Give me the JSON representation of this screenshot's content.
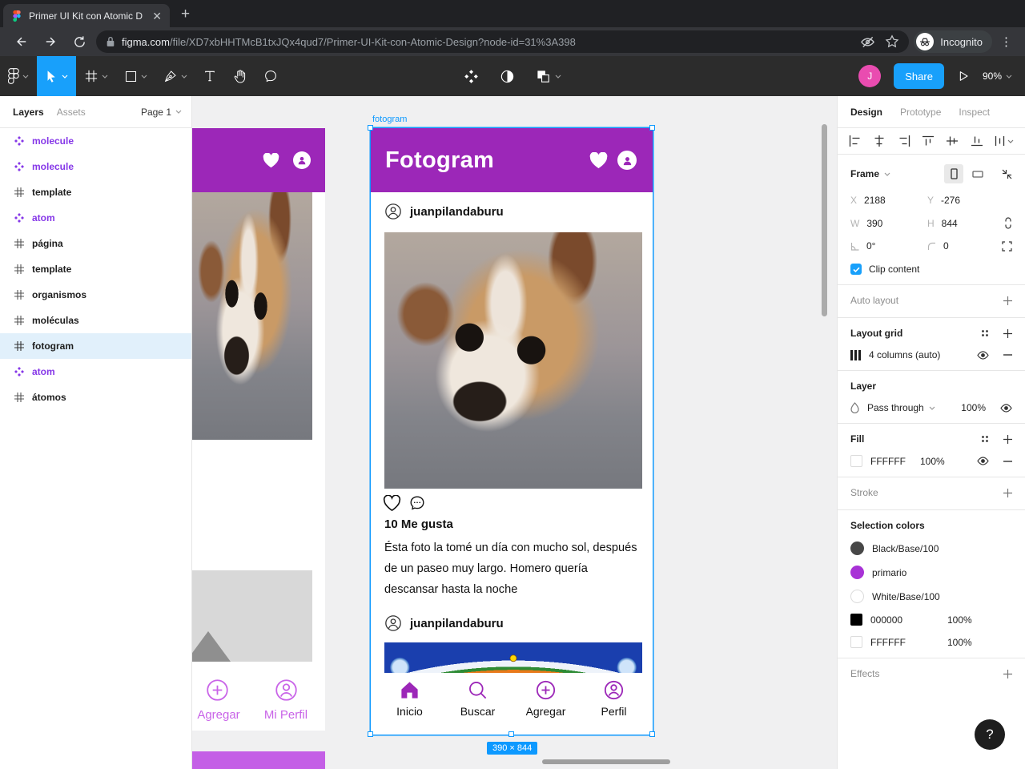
{
  "browser": {
    "tab_title": "Primer UI Kit con Atomic D",
    "url_domain": "figma.com",
    "url_path": "/file/XD7xbHHTMcB1txJQx4qud7/Primer-UI-Kit-con-Atomic-Design?node-id=31%3A398",
    "incognito_label": "Incognito"
  },
  "figma_toolbar": {
    "share_label": "Share",
    "zoom_level": "90%",
    "avatar_initial": "J"
  },
  "layers_panel": {
    "layers_tab": "Layers",
    "assets_tab": "Assets",
    "page_label": "Page 1",
    "items": [
      {
        "label": "molecule",
        "type": "component"
      },
      {
        "label": "molecule",
        "type": "component"
      },
      {
        "label": "template",
        "type": "frame"
      },
      {
        "label": "atom",
        "type": "component"
      },
      {
        "label": "página",
        "type": "frame"
      },
      {
        "label": "template",
        "type": "frame"
      },
      {
        "label": "organismos",
        "type": "frame"
      },
      {
        "label": "moléculas",
        "type": "frame"
      },
      {
        "label": "fotogram",
        "type": "frame",
        "selected": true
      },
      {
        "label": "atom",
        "type": "component"
      },
      {
        "label": "átomos",
        "type": "frame"
      }
    ]
  },
  "canvas": {
    "selected_frame_label": "fotogram",
    "size_badge": "390 × 844",
    "app": {
      "title": "Fotogram",
      "posts": [
        {
          "username": "juanpilandaburu",
          "likes_label": "10 Me gusta",
          "caption": "Ésta foto la tomé un día con mucho sol, después de un paseo muy largo. Homero quería descansar hasta la noche"
        },
        {
          "username": "juanpilandaburu"
        }
      ],
      "nav_items": [
        "Inicio",
        "Buscar",
        "Agregar",
        "Perfil"
      ]
    },
    "side_frame": {
      "nav_items": [
        "Agregar",
        "Mi Perfil"
      ]
    }
  },
  "inspector": {
    "tabs": [
      "Design",
      "Prototype",
      "Inspect"
    ],
    "frame": {
      "section_label": "Frame",
      "x_label": "X",
      "x_value": "2188",
      "y_label": "Y",
      "y_value": "-276",
      "w_label": "W",
      "w_value": "390",
      "h_label": "H",
      "h_value": "844",
      "rotation_value": "0°",
      "radius_value": "0",
      "clip_label": "Clip content"
    },
    "auto_layout_label": "Auto layout",
    "layout_grid": {
      "label": "Layout grid",
      "value": "4 columns (auto)"
    },
    "layer": {
      "label": "Layer",
      "blend_mode": "Pass through",
      "opacity": "100%"
    },
    "fill": {
      "label": "Fill",
      "hex": "FFFFFF",
      "opacity": "100%"
    },
    "stroke_label": "Stroke",
    "selection_colors": {
      "label": "Selection colors",
      "items": [
        {
          "name": "Black/Base/100",
          "swatch": "#474747"
        },
        {
          "name": "primario",
          "swatch": "#A832D6"
        },
        {
          "name": "White/Base/100",
          "swatch": "#FFFFFF"
        },
        {
          "name": "000000",
          "opacity": "100%",
          "swatch": "#000000"
        },
        {
          "name": "FFFFFF",
          "opacity": "100%",
          "swatch": "#FFFFFF"
        }
      ]
    },
    "effects_label": "Effects",
    "help_label": "?"
  },
  "colors": {
    "accent_blue": "#18A0FB",
    "selection_blue": "#0D99FF",
    "primary_purple": "#9C27B8",
    "light_purple": "#C964E8",
    "component_purple": "#8638E8",
    "avatar_pink": "#E94CB0"
  }
}
